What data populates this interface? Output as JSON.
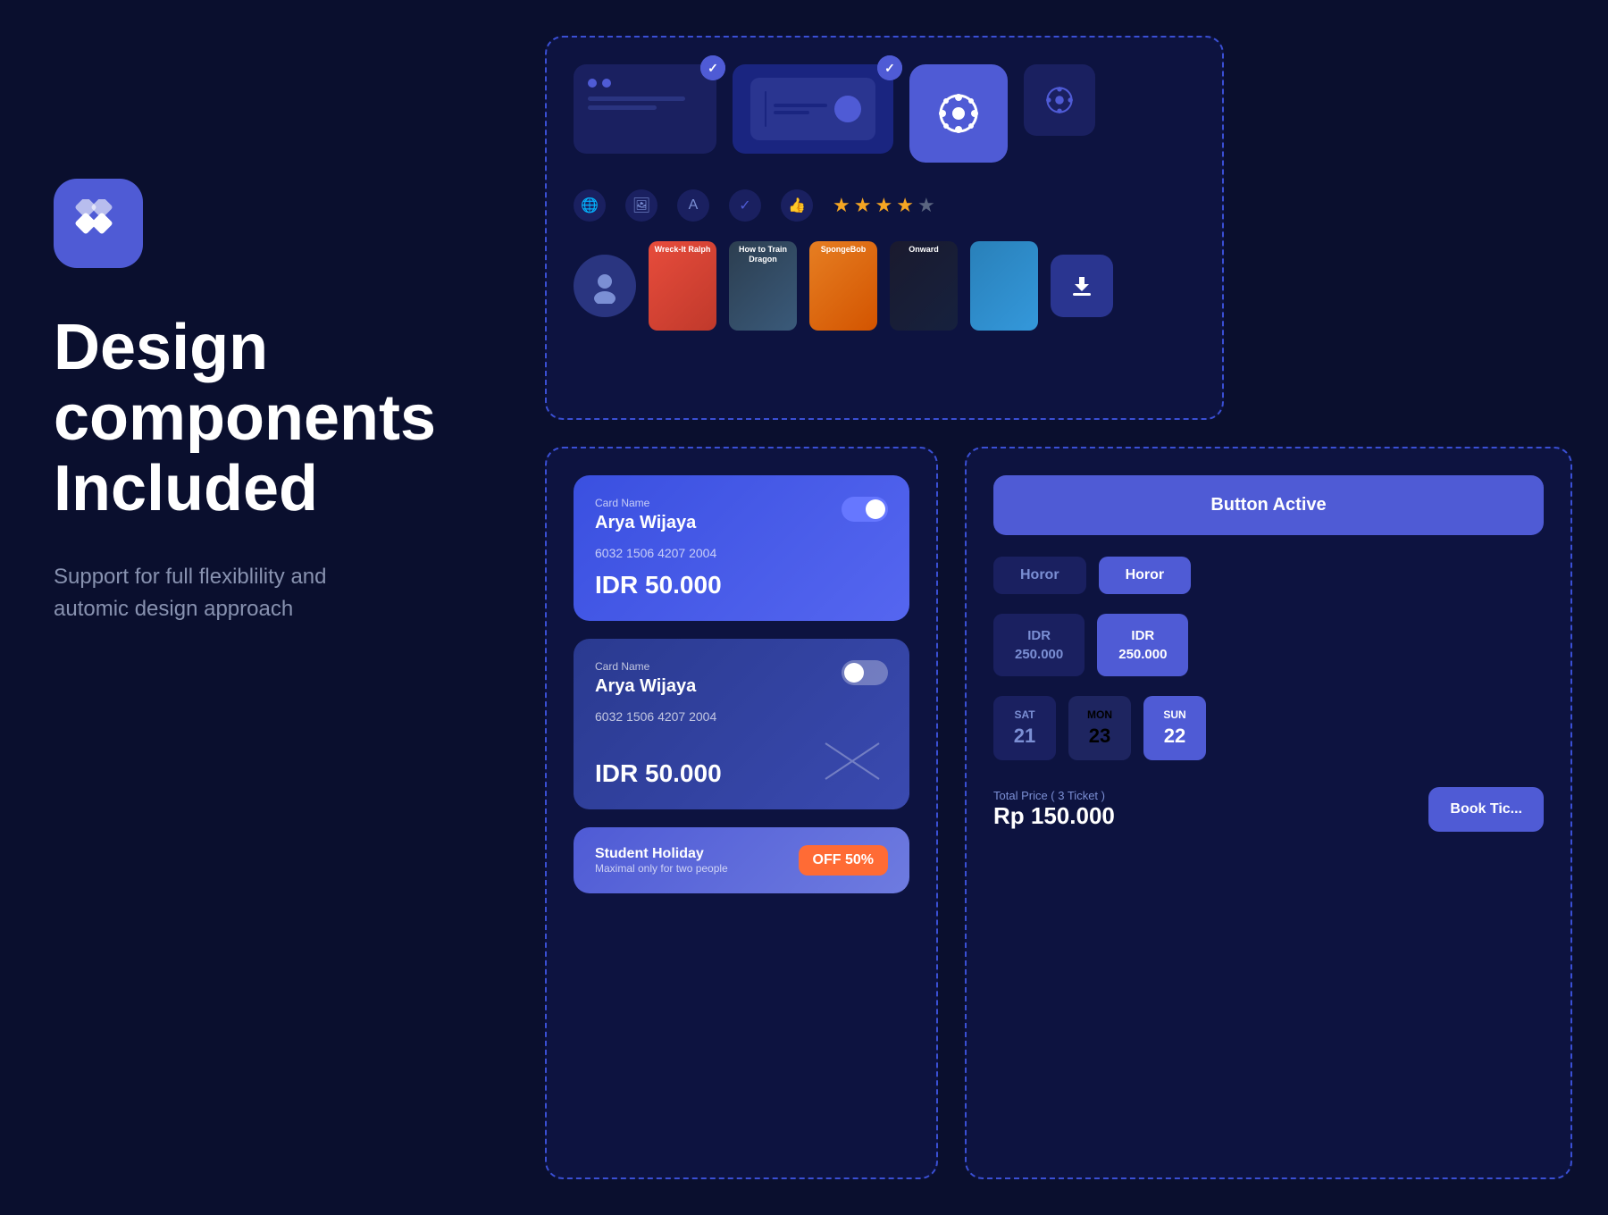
{
  "app": {
    "title": "Design components Included",
    "subtitle": "Support for full flexiblility and automic design approach"
  },
  "left": {
    "icon_label": "app-icon",
    "headline": "Design components Included",
    "subtitle": "Support for full flexiblility and automic design approach"
  },
  "top_showcase": {
    "cards": [
      {
        "type": "ui-card",
        "selected": true
      },
      {
        "type": "ticket",
        "selected": true
      },
      {
        "type": "film-icon-large"
      },
      {
        "type": "film-icon-small"
      }
    ],
    "icons": [
      "globe",
      "image",
      "translate",
      "check",
      "thumbs-up"
    ],
    "stars": 4.5,
    "movies": [
      "Wreck-It Ralph",
      "How to Train Your Dragon",
      "SpongeBob",
      "Onward",
      "download"
    ]
  },
  "bottom_left": {
    "cards": [
      {
        "label": "Card Name",
        "name": "Arya Wijaya",
        "number": "6032 1506 4207 2004",
        "amount": "IDR 50.000",
        "toggle": "on"
      },
      {
        "label": "Card Name",
        "name": "Arya Wijaya",
        "number": "6032 1506 4207 2004",
        "amount": "IDR 50.000",
        "toggle": "off"
      }
    ],
    "promo": {
      "title": "Student Holiday",
      "subtitle": "Maximal only for two people",
      "badge": "OFF 50%"
    }
  },
  "bottom_right": {
    "button_active_label": "Button Active",
    "genres": [
      {
        "label": "Horor",
        "active": false
      },
      {
        "label": "Horor",
        "active": true
      }
    ],
    "prices": [
      {
        "label": "IDR\n250.000",
        "active": false
      },
      {
        "label": "IDR\n250.000",
        "active": true
      }
    ],
    "dates": [
      {
        "day": "SAT",
        "num": "21",
        "active": false
      },
      {
        "day": "MON",
        "num": "23",
        "active": false
      },
      {
        "day": "SUN",
        "num": "22",
        "active": true
      }
    ],
    "total_label": "Total Price ( 3 Ticket )",
    "total_price": "Rp 150.000",
    "book_btn": "Book Tic..."
  }
}
